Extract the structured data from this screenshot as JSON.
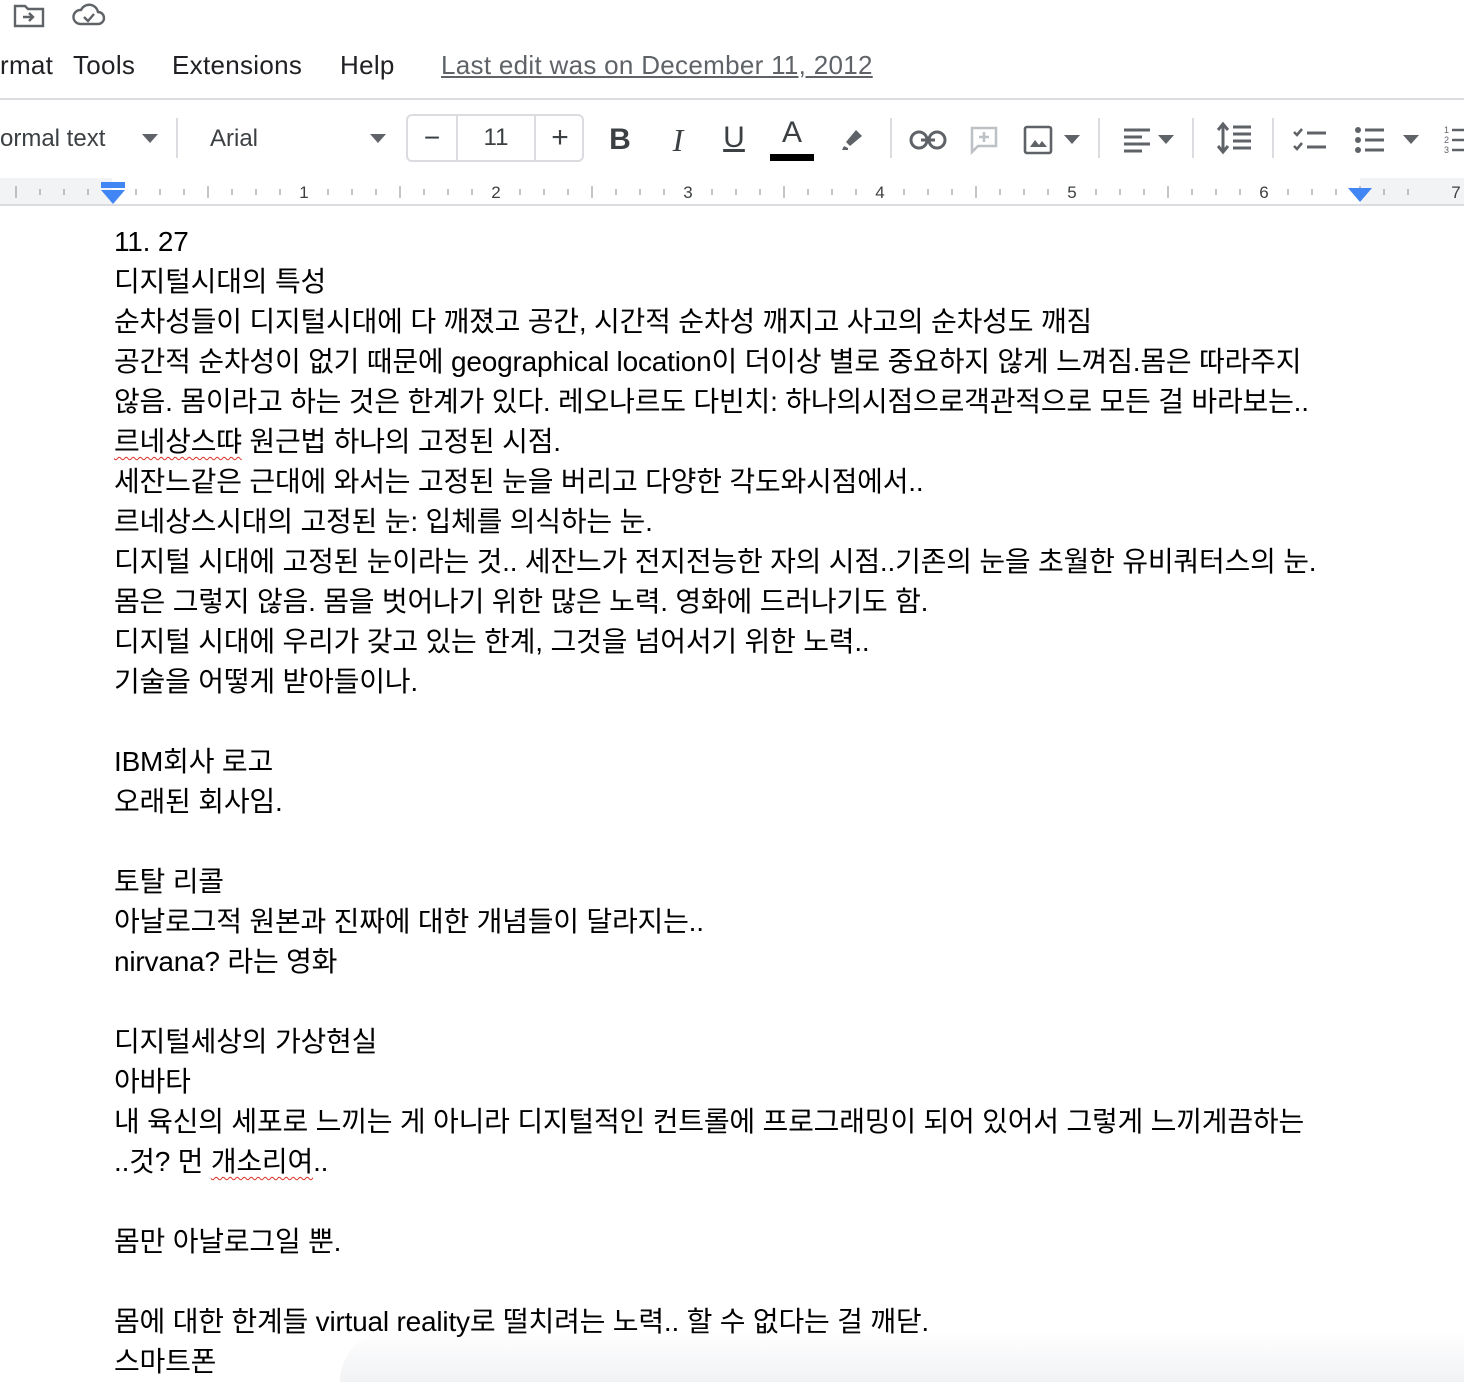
{
  "top_icons": [
    "move-to-folder-icon",
    "cloud-saved-icon"
  ],
  "menu": {
    "items": [
      "rmat",
      "Tools",
      "Extensions",
      "Help"
    ],
    "last_edit": "Last edit was on December 11, 2012"
  },
  "toolbar": {
    "style": "ormal text",
    "font": "Arial",
    "font_size": "11",
    "minus": "−",
    "plus": "+",
    "bold": "B",
    "italic": "I",
    "underline": "U",
    "text_color_letter": "A",
    "text_color": "#000000",
    "icons": [
      "insert-link-icon",
      "add-comment-icon",
      "insert-image-icon",
      "align-left-icon",
      "line-spacing-icon",
      "checklist-icon",
      "bulleted-list-icon",
      "numbered-list-icon"
    ]
  },
  "ruler": {
    "numbers": [
      "1",
      "2",
      "3",
      "4",
      "5",
      "6",
      "7"
    ]
  },
  "document": {
    "lines": [
      "11. 27",
      "디지털시대의 특성",
      "순차성들이 디지털시대에 다 깨졌고 공간, 시간적 순차성 깨지고 사고의 순차성도 깨짐",
      "공간적 순차성이 없기 때문에 geographical location이 더이상 별로 중요하지 않게 느껴짐.몸은 따라주지",
      "않음. 몸이라고 하는 것은 한계가 있다. 레오나르도 다빈치: 하나의시점으로객관적으로 모든 걸 바라보는..",
      "르네상스땨 원근법 하나의 고정된 시점.",
      "세잔느같은 근대에 와서는 고정된 눈을 버리고 다양한 각도와시점에서..",
      "르네상스시대의 고정된 눈: 입체를 의식하는 눈.",
      "디지털 시대에 고정된 눈이라는 것.. 세잔느가 전지전능한 자의 시점..기존의 눈을 초월한 유비쿼터스의 눈.",
      "몸은 그렇지 않음. 몸을 벗어나기 위한 많은 노력. 영화에 드러나기도 함.",
      "디지털 시대에 우리가 갖고 있는 한계, 그것을 넘어서기 위한 노력..",
      "기술을 어떻게 받아들이나.",
      "",
      "IBM회사 로고",
      "오래된 회사임.",
      "",
      "토탈 리콜",
      "아날로그적 원본과 진짜에 대한 개념들이 달라지는..",
      "nirvana? 라는 영화",
      "",
      "디지털세상의 가상현실",
      "아바타",
      "내 육신의 세포로 느끼는 게 아니라 디지털적인 컨트롤에 프로그래밍이 되어 있어서 그렇게 느끼게끔하는",
      "..것? 먼 개소리여..",
      "",
      "몸만 아날로그일 뿐.",
      "",
      "몸에 대한 한계들 virtual reality로 떨치려는 노력.. 할 수 없다는 걸 깨닫.",
      "스마트폰"
    ],
    "line6_pre": "르네상스땨",
    "line6_post": " 원근법 하나의 고정된 시점.",
    "line24_pre": "..것? 먼 ",
    "line24_mid": "개소리여",
    "line24_post": ".."
  }
}
